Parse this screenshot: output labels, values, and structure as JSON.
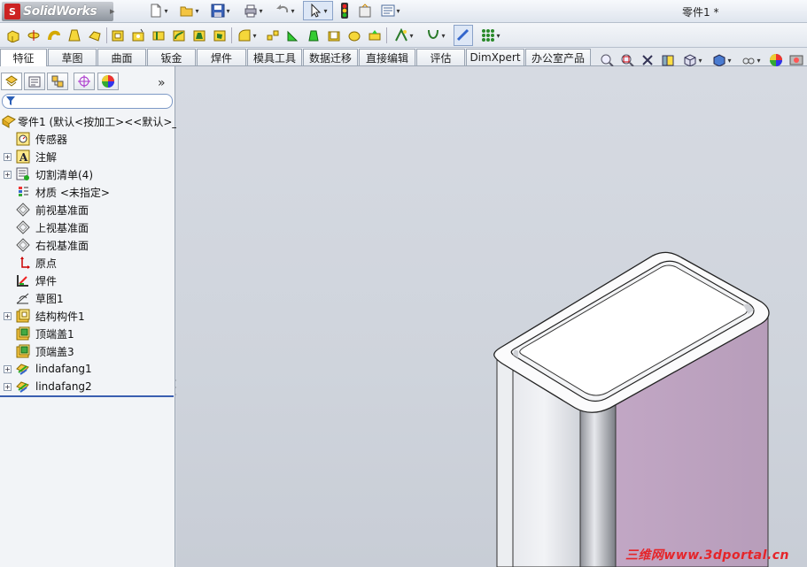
{
  "app": {
    "logo_text": "SolidWorks",
    "document_title": "零件1 *"
  },
  "title_toolbar": {
    "icons": [
      "new-document-icon",
      "open-folder-icon",
      "save-icon",
      "print-icon",
      "undo-icon",
      "select-arrow-icon",
      "rebuild-traffic-light-icon",
      "file-properties-icon",
      "options-icon"
    ]
  },
  "feature_toolbar": {
    "icons": [
      "extruded-boss-icon",
      "revolved-boss-icon",
      "swept-boss-icon",
      "lofted-boss-icon",
      "boundary-boss-icon",
      "extruded-cut-icon",
      "hole-wizard-icon",
      "revolved-cut-icon",
      "swept-cut-icon",
      "lofted-cut-icon",
      "boundary-cut-icon",
      "fillet-icon",
      "linear-pattern-icon",
      "rib-icon",
      "draft-icon",
      "shell-icon",
      "wrap-icon",
      "dome-icon",
      "mirror-icon",
      "reference-geometry-icon",
      "curves-icon",
      "instant3d-icon",
      "grid-icon"
    ]
  },
  "command_tabs": [
    {
      "label": "特征",
      "active": true
    },
    {
      "label": "草图"
    },
    {
      "label": "曲面"
    },
    {
      "label": "钣金"
    },
    {
      "label": "焊件"
    },
    {
      "label": "模具工具"
    },
    {
      "label": "数据迁移"
    },
    {
      "label": "直接编辑"
    },
    {
      "label": "评估"
    },
    {
      "label": "DimXpert"
    },
    {
      "label": "办公室产品"
    }
  ],
  "view_toolbar": {
    "icons": [
      "zoom-to-fit-icon",
      "zoom-area-icon",
      "previous-view-icon",
      "section-view-icon",
      "view-orientation-icon",
      "display-style-icon",
      "hide-show-items-icon",
      "edit-appearance-icon",
      "apply-scene-icon"
    ]
  },
  "panel_tabs": {
    "icons": [
      "featuremanager-tree-icon",
      "propertymanager-icon",
      "configurationmanager-icon",
      "dimxpertmanager-icon",
      "displaymanager-icon"
    ],
    "expand_glyph": "»"
  },
  "feature_tree": {
    "root": "零件1  (默认<按加工><<默认>_",
    "items": [
      {
        "label": "传感器",
        "icon": "sensor-icon",
        "expandable": false
      },
      {
        "label": "注解",
        "icon": "annotations-icon",
        "expandable": true
      },
      {
        "label": "切割清单(4)",
        "icon": "cut-list-icon",
        "expandable": true
      },
      {
        "label": "材质 <未指定>",
        "icon": "material-icon",
        "expandable": false
      },
      {
        "label": "前视基准面",
        "icon": "plane-icon",
        "expandable": false
      },
      {
        "label": "上视基准面",
        "icon": "plane-icon",
        "expandable": false
      },
      {
        "label": "右视基准面",
        "icon": "plane-icon",
        "expandable": false
      },
      {
        "label": "原点",
        "icon": "origin-icon",
        "expandable": false
      },
      {
        "label": "焊件",
        "icon": "weldment-icon",
        "expandable": false
      },
      {
        "label": "草图1",
        "icon": "sketch-icon",
        "expandable": false
      },
      {
        "label": "结构构件1",
        "icon": "structural-member-icon",
        "expandable": true
      },
      {
        "label": "顶端盖1",
        "icon": "end-cap-icon",
        "expandable": false
      },
      {
        "label": "顶端盖3",
        "icon": "end-cap-icon",
        "expandable": false
      },
      {
        "label": "lindafang1",
        "icon": "feature-icon",
        "expandable": true
      },
      {
        "label": "lindafang2",
        "icon": "feature-icon",
        "expandable": true
      }
    ]
  },
  "watermark": "三维网www.3dportal.cn"
}
